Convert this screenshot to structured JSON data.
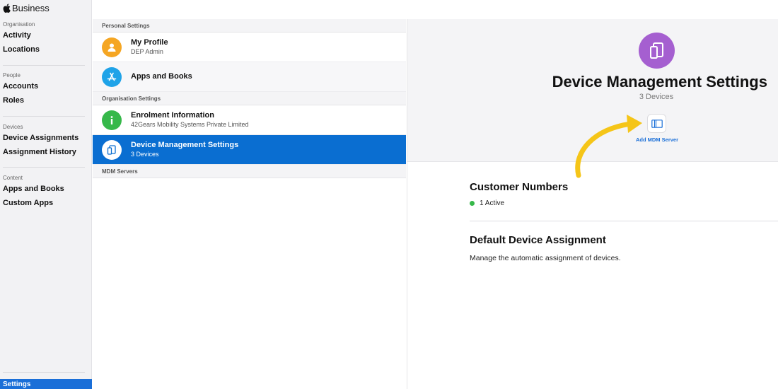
{
  "sidebar": {
    "brand": "Business",
    "sections": [
      {
        "header": "Organisation",
        "items": [
          "Activity",
          "Locations"
        ]
      },
      {
        "header": "People",
        "items": [
          "Accounts",
          "Roles"
        ]
      },
      {
        "header": "Devices",
        "items": [
          "Device Assignments",
          "Assignment History"
        ]
      },
      {
        "header": "Content",
        "items": [
          "Apps and Books",
          "Custom Apps"
        ]
      }
    ],
    "settings_label": "Settings"
  },
  "middle": {
    "personal_header": "Personal Settings",
    "my_profile": {
      "title": "My Profile",
      "subtitle": "DEP Admin"
    },
    "apps_books": {
      "title": "Apps and Books"
    },
    "org_header": "Organisation Settings",
    "enrolment": {
      "title": "Enrolment Information",
      "subtitle": "42Gears Mobility Systems Private Limited"
    },
    "device_mgmt": {
      "title": "Device Management Settings",
      "subtitle": "3 Devices"
    },
    "mdm_header": "MDM Servers"
  },
  "detail": {
    "title": "Device Management Settings",
    "subtitle": "3 Devices",
    "add_mdm_label": "Add MDM Server",
    "customer_numbers_title": "Customer Numbers",
    "active_text": "1 Active",
    "default_assignment_title": "Default Device Assignment",
    "default_assignment_desc": "Manage the automatic assignment of devices."
  },
  "colors": {
    "accent": "#0a6ed1",
    "profile_icon": "#f5a623",
    "apps_icon": "#1fa3e8",
    "info_icon": "#36b84a",
    "device_icon": "#a55fd0",
    "arrow": "#f5c518"
  },
  "icons": {
    "profile": "person-icon",
    "apps": "app-store-icon",
    "info": "info-icon",
    "device": "tablet-icon",
    "mdm": "server-icon"
  }
}
